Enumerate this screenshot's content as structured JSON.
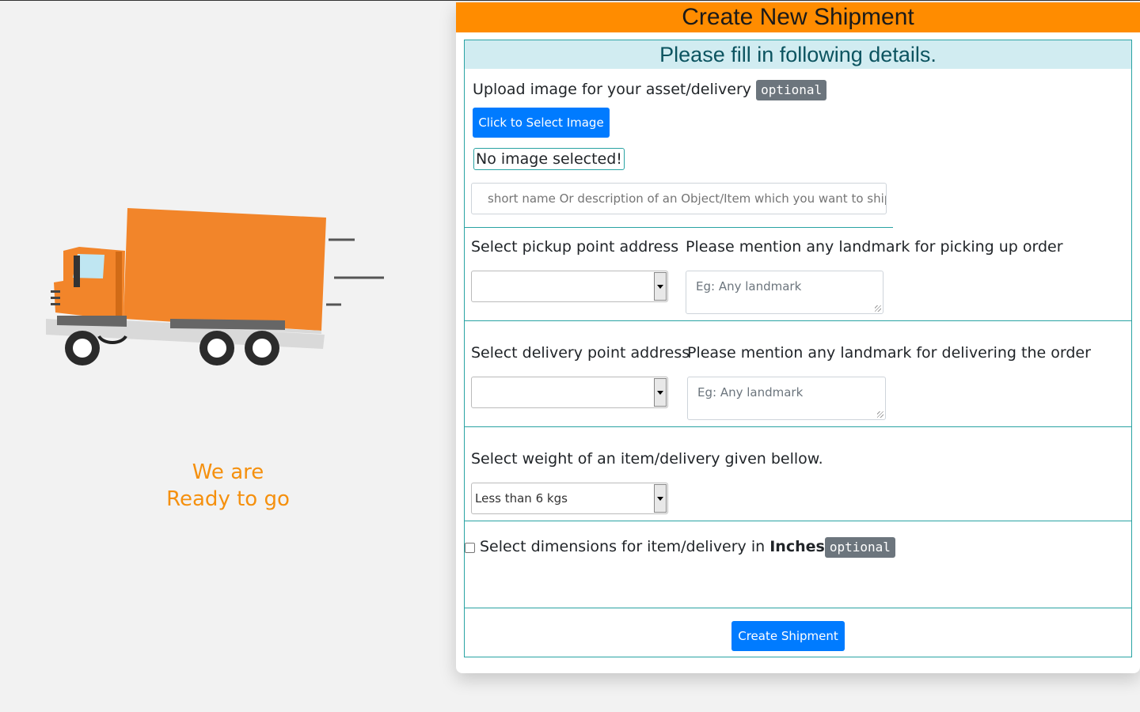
{
  "hero": {
    "tagline_line1": "We are",
    "tagline_line2": "Ready to go",
    "accent_color": "#f5900e"
  },
  "card": {
    "title": "Create New Shipment",
    "header_color": "#ff8c00"
  },
  "form": {
    "heading": "Please fill in following details.",
    "upload": {
      "label": "Upload image for your asset/delivery",
      "badge": "optional",
      "button_label": "Click to Select Image",
      "status": "No image selected!"
    },
    "item_name": {
      "placeholder": "short name Or description of an Object/Item which you want to ship."
    },
    "pickup": {
      "label": "Select pickup point address",
      "selected": "",
      "landmark_label": "Please mention any landmark for picking up order",
      "landmark_placeholder": "Eg: Any landmark"
    },
    "delivery": {
      "label": "Select delivery point address",
      "selected": "",
      "landmark_label": "Please mention any landmark for delivering the order",
      "landmark_placeholder": "Eg: Any landmark"
    },
    "weight": {
      "label": "Select weight of an item/delivery given bellow.",
      "selected": "Less than 6 kgs"
    },
    "dimensions": {
      "label": "Select dimensions for item/delivery in ",
      "unit": "Inches",
      "badge": "optional",
      "checked": false
    },
    "submit_label": "Create Shipment",
    "primary_color": "#007bff"
  }
}
